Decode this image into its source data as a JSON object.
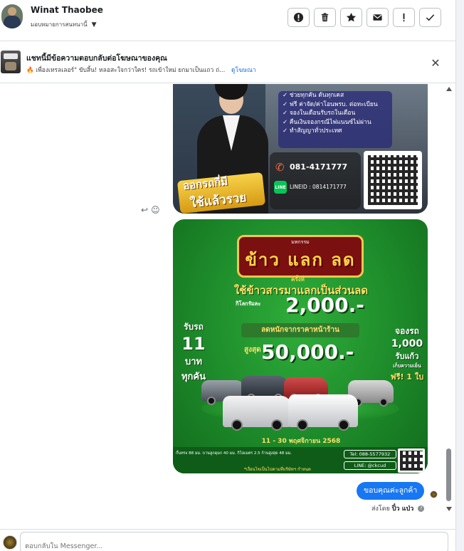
{
  "header": {
    "contact_name": "Winat Thaobee",
    "assign_label": "มอบหมายการสนทนานี้",
    "actions": [
      {
        "name": "report-spam-button",
        "icon": "alert-circle-icon"
      },
      {
        "name": "delete-button",
        "icon": "trash-icon"
      },
      {
        "name": "star-button",
        "icon": "star-icon"
      },
      {
        "name": "mark-unread-button",
        "icon": "envelope-icon"
      },
      {
        "name": "follow-up-button",
        "icon": "exclamation-icon"
      },
      {
        "name": "mark-done-button",
        "icon": "check-icon"
      }
    ]
  },
  "ad_banner": {
    "title": "แชทนี้มีข้อความตอบกลับต่อโฆษณาของคุณ",
    "description": "🔥 เพื่องเทรลเลอร์\" ขับสิ้น! หลอสะใจกว่าใคร! รถเข้าใหม่ ยกมาเป็นแถว ถ่...",
    "link": "ดูโฆษณา"
  },
  "image1": {
    "checklist": [
      "✓ ช่วยทุกคัน ดันทุกเคส",
      "✓ ฟรี ค่าจัด/ค่าโอนพรบ. ต่อทะเบียน",
      "✓ จองในเดือนรับรถในเดือน",
      "✓ คืนเงินจองกรณีไฟแนนซ์ไม่ผ่าน",
      "✓ ทำสัญญาทั่วประเทศ"
    ],
    "tag_line1": "ออกรถกี่มี",
    "tag_line2": "ใช้แล้วรวย",
    "phone": "081-4171777",
    "line_label": "LINE",
    "line_id": "LINEID : 0814171777"
  },
  "image2": {
    "event_small": "มหกรรม",
    "event_title": "ข้าว แลก ลด",
    "round": "ครั้งที่",
    "use_rice": "ใช้ข้าวสารมาแลกเป็นส่วนลด",
    "per_kg": "กิโลกรัมละ",
    "price1": "2,000.-",
    "discount": "ลดหนักจากราคาหน้าร้าน",
    "up_to": "สูงสุด",
    "price2": "50,000.-",
    "left_l1": "รับรถ",
    "left_l2": "11",
    "left_l3": "บาท",
    "left_l4": "ทุกคัน",
    "right_r1": "จองรถ",
    "right_r2": "1,000",
    "right_r3": "รับแก้ว",
    "right_r4": "เก็บความเย็น",
    "right_r5": "ฟรี! 1 ใบ",
    "date": "11 - 30 พฤศจิกายน 2568",
    "footer_left": "กั้นทรง 88 มม. บานลูกดุมก 40 มม. กิโลเมตร 2.5 ก้านสูงสุด 48 มม.",
    "footer_bottom": "*เงื่อนไขเป็นไปตามที่บริษัทฯ กำหนด",
    "tel": "Tel: 088-5577932",
    "line": "LINE: @ckcud"
  },
  "sent_message": {
    "text": "ขอบคุณค่ะลูกค้า",
    "sent_by_label": "ส่งโดย",
    "sender": "ปิ๋ว แป่ว"
  },
  "composer": {
    "placeholder": "ตอบกลับใน Messenger..."
  },
  "colors": {
    "bubble": "#1877f2",
    "link": "#216fdb",
    "promo_green": "#1d8a2a"
  }
}
